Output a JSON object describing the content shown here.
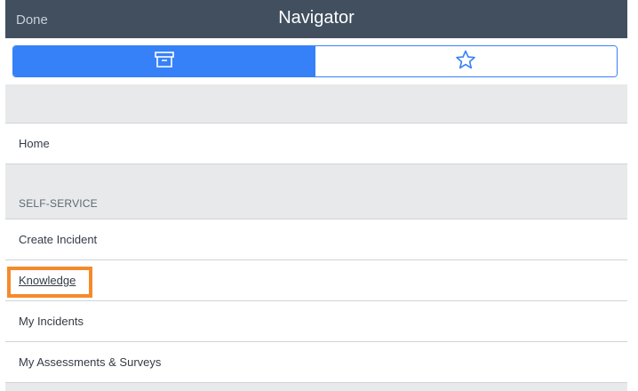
{
  "header": {
    "done_label": "Done",
    "title": "Navigator"
  },
  "tabs": [
    {
      "name": "all-applications",
      "icon": "archive-box-icon",
      "active": true
    },
    {
      "name": "favorites",
      "icon": "star-icon",
      "active": false
    }
  ],
  "home": {
    "label": "Home"
  },
  "section": {
    "title": "SELF-SERVICE"
  },
  "items": [
    {
      "label": "Create Incident"
    },
    {
      "label": "Knowledge",
      "highlighted": true
    },
    {
      "label": "My Incidents"
    },
    {
      "label": "My Assessments & Surveys"
    }
  ],
  "colors": {
    "header_bg": "#414f5f",
    "accent": "#3781f8",
    "highlight": "#f58a2c",
    "background": "#e8e9eb"
  }
}
